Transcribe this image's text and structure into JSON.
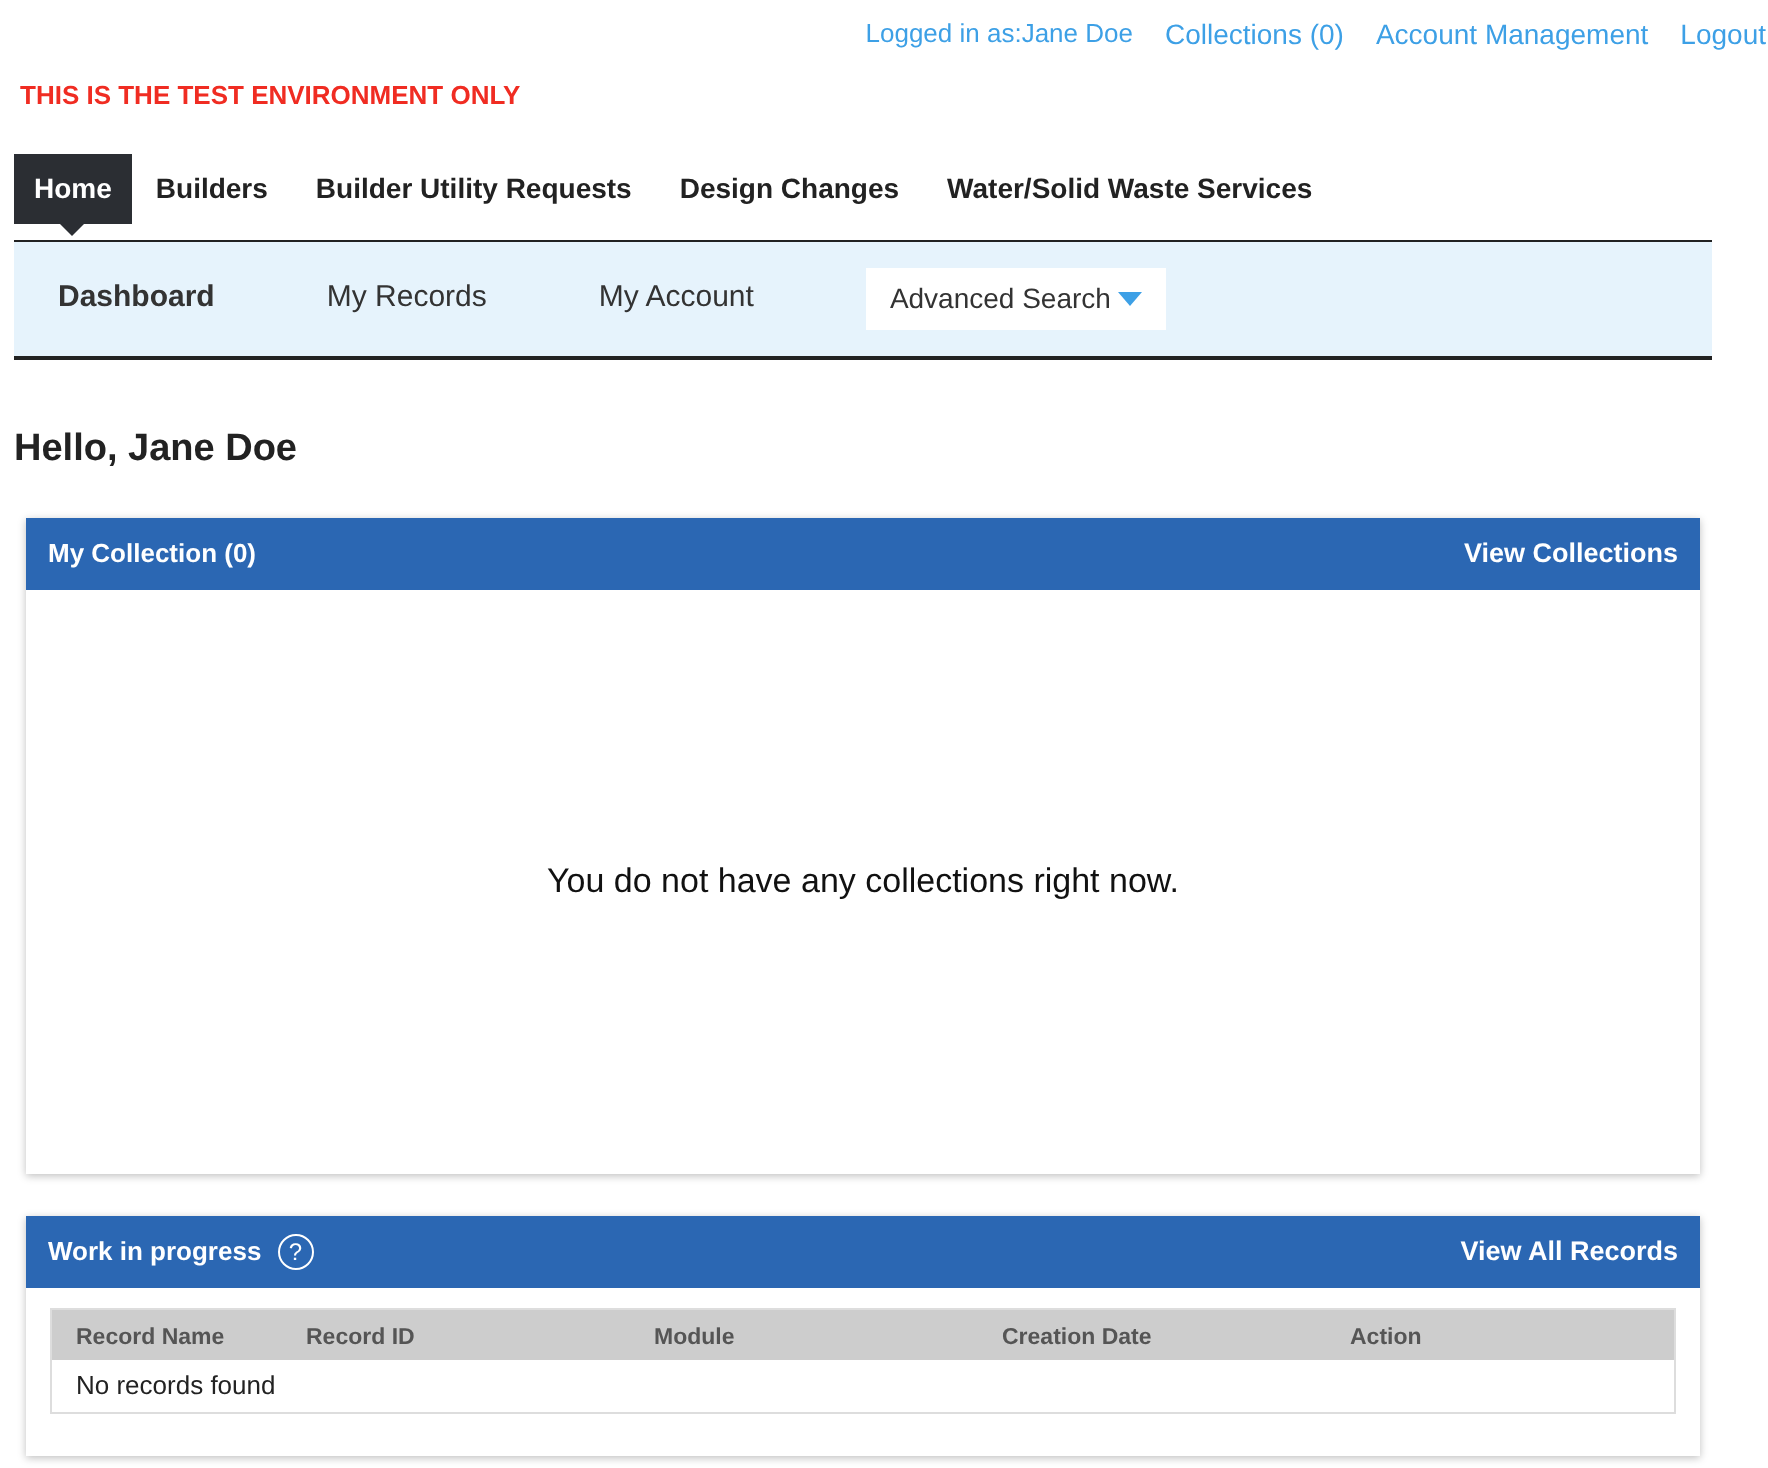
{
  "top_links": [
    {
      "label": "Logged in as:Jane Doe"
    },
    {
      "label": "Collections (0)"
    },
    {
      "label": "Account Management"
    },
    {
      "label": "Logout"
    }
  ],
  "environment_notice": "THIS IS THE TEST ENVIRONMENT ONLY",
  "main_nav": [
    {
      "label": "Home",
      "selected": true
    },
    {
      "label": "Builders",
      "selected": false
    },
    {
      "label": "Builder Utility Requests",
      "selected": false
    },
    {
      "label": "Design Changes",
      "selected": false
    },
    {
      "label": "Water/Solid Waste Services",
      "selected": false
    }
  ],
  "sub_nav": [
    {
      "label": "Dashboard",
      "kind": "link",
      "selected": true
    },
    {
      "label": "My Records",
      "kind": "link",
      "selected": false
    },
    {
      "label": "My Account",
      "kind": "link",
      "selected": false
    },
    {
      "label": "Advanced Search",
      "kind": "dropdown",
      "selected": false
    }
  ],
  "greeting": "Hello, Jane Doe",
  "collection_panel": {
    "title": "My Collection (0)",
    "link": "View Collections",
    "empty_message": "You do not have any collections right now."
  },
  "work_panel": {
    "title": "Work in progress",
    "help": "?",
    "link": "View All Records",
    "table": {
      "columns": [
        "Record Name",
        "Record ID",
        "Module",
        "Creation Date",
        "Action"
      ],
      "empty_message": "No records found"
    }
  }
}
